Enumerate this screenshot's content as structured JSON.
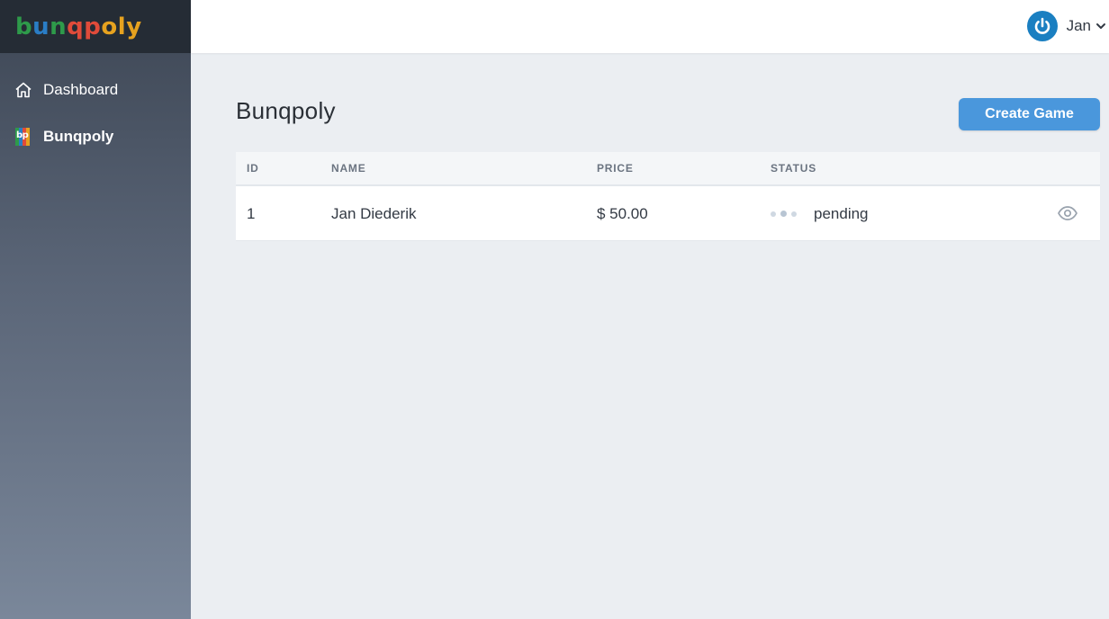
{
  "brand": {
    "letters": [
      "b",
      "u",
      "n",
      "q",
      "p",
      "o",
      "l",
      "y"
    ],
    "colors": [
      "#2e9a4a",
      "#2a7dc5",
      "#2e9a4a",
      "#e04b3a",
      "#e04b3a",
      "#e6a21f",
      "#e6a21f",
      "#e6a21f"
    ]
  },
  "sidebar": {
    "items": [
      {
        "label": "Dashboard",
        "icon": "home-icon",
        "active": false
      },
      {
        "label": "Bunqpoly",
        "icon": "bunqpoly-icon",
        "active": true
      }
    ]
  },
  "topbar": {
    "user_name": "Jan",
    "avatar_icon": "power-icon",
    "menu_icon": "chevron-down-icon"
  },
  "main": {
    "title": "Bunqpoly",
    "create_button_label": "Create Game",
    "table": {
      "columns": [
        "ID",
        "NAME",
        "PRICE",
        "STATUS"
      ],
      "rows": [
        {
          "id": "1",
          "name": "Jan Diederik",
          "price": "$ 50.00",
          "status": "pending"
        }
      ]
    }
  },
  "colors": {
    "accent": "#4a97dc",
    "avatar": "#1a7fc1",
    "sidebar_top": "#3d4654",
    "brand_bg": "#252c35"
  }
}
